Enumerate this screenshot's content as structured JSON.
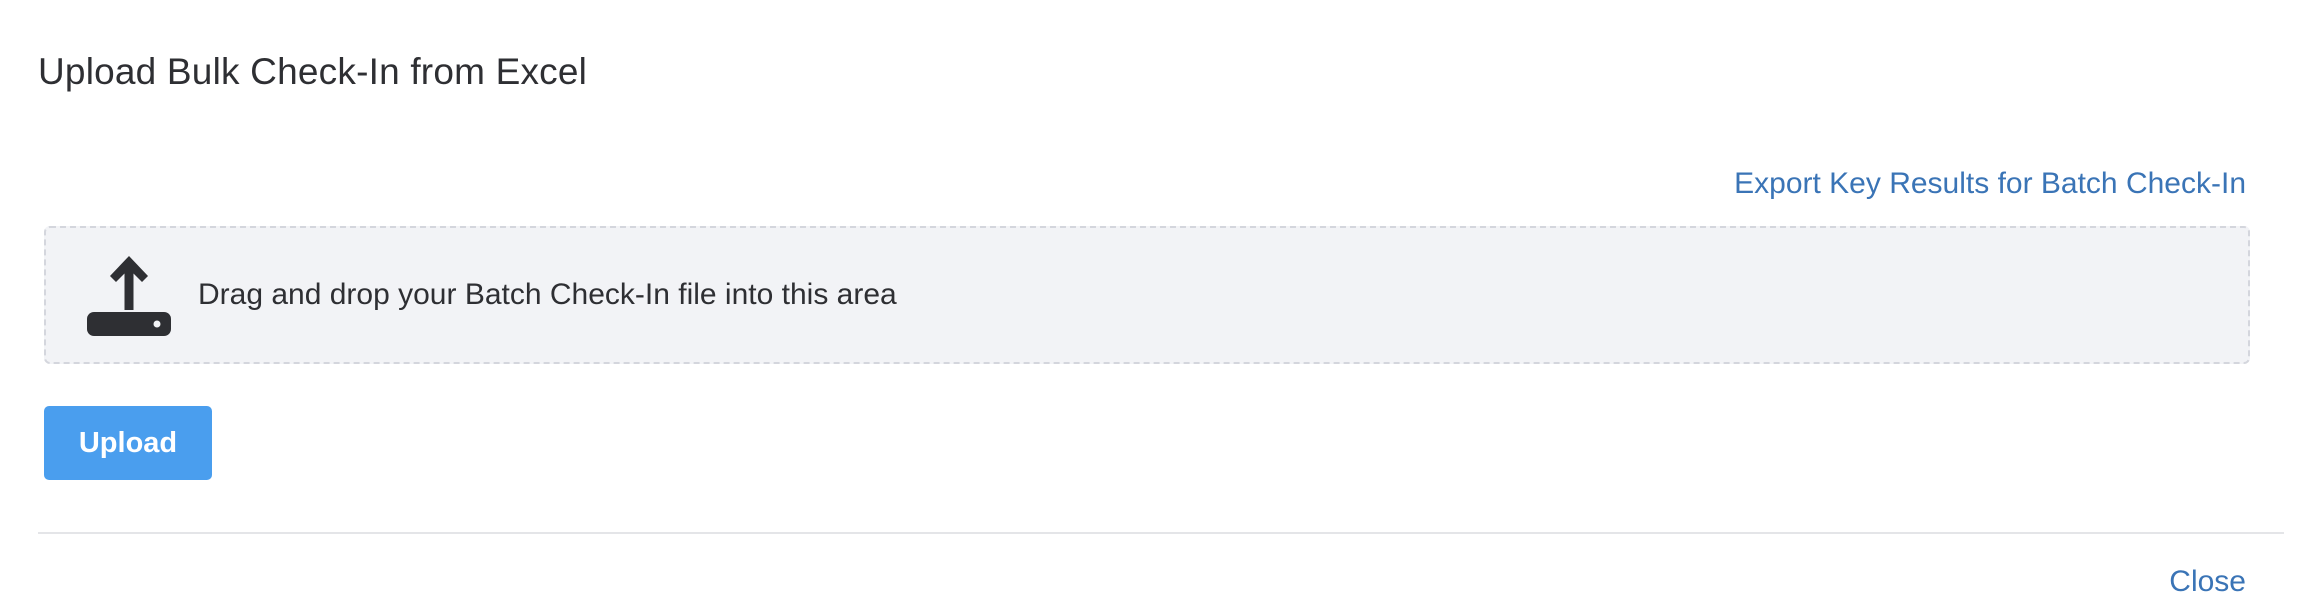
{
  "dialog": {
    "title": "Upload Bulk Check-In from Excel",
    "export_link": "Export Key Results for Batch Check-In",
    "dropzone": {
      "icon": "upload-icon",
      "text": "Drag and drop your Batch Check-In file into this area"
    },
    "upload_button": "Upload",
    "close_link": "Close"
  },
  "colors": {
    "link": "#3a74b6",
    "button": "#4a9eee",
    "dropzone_bg": "#f2f3f6",
    "icon": "#2e2f33"
  }
}
